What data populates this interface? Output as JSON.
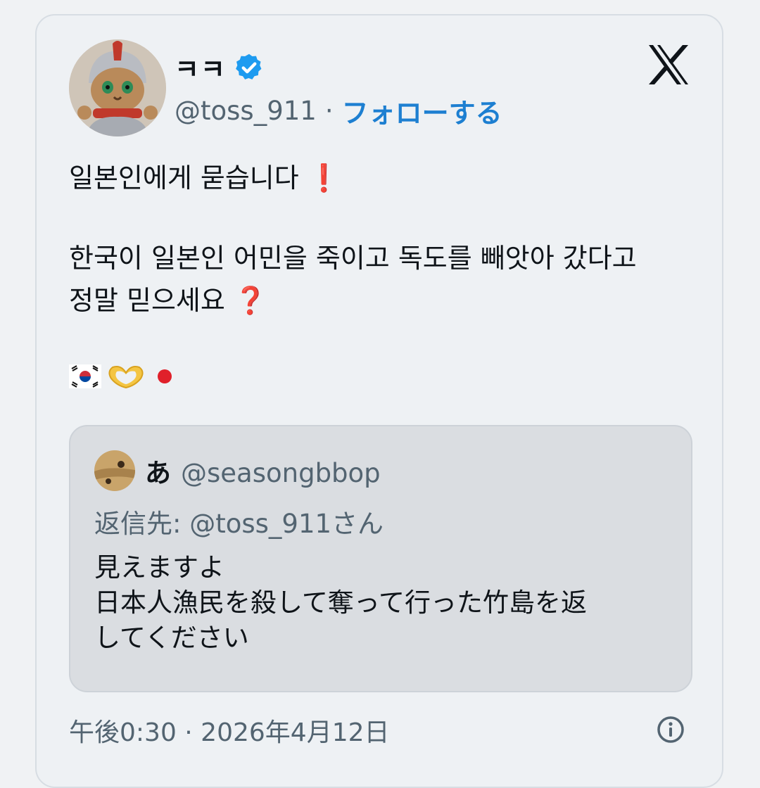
{
  "post": {
    "author": {
      "display_name": "ㅋㅋ",
      "handle": "@toss_911",
      "verified_icon": "verified-badge-icon",
      "separator": "·",
      "follow_label": "フォローする"
    },
    "body": {
      "line1": "일본인에게 묻습니다",
      "line1_emoji": "❗",
      "line2": "한국이 일본인 어민을 죽이고 독도를 빼앗아 갔다고",
      "line3": "정말 믿으세요",
      "line3_emoji": "❓",
      "emojis": [
        "korean-flag-icon",
        "heart-hands-icon",
        "red-circle-icon"
      ]
    },
    "timestamp": "午後0:30 · 2026年4月12日"
  },
  "quoted_post": {
    "author_name": "あ",
    "author_handle": "@seasongbbop",
    "reply_to": "返信先: @toss_911さん",
    "lines": [
      "見えますよ",
      "日本人漁民を殺して奪って行った竹島を返",
      "してください"
    ]
  },
  "colors": {
    "accent": "#1d7fd1",
    "verified": "#1d9bf0",
    "secondary_text": "#536471",
    "emphasis_red": "#d0202d"
  }
}
